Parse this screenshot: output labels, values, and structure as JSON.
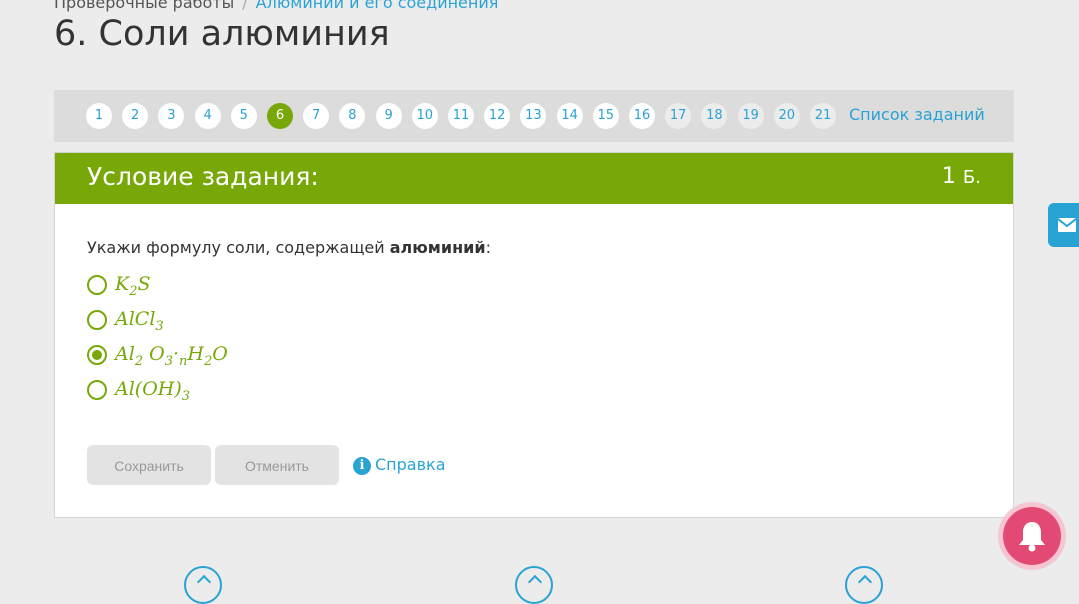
{
  "breadcrumb": {
    "parent": "Проверочные работы",
    "separator": "/",
    "current": "Алюминий и его соединения"
  },
  "page_title": "6. Соли алюминия",
  "pager": {
    "numbers": [
      "1",
      "2",
      "3",
      "4",
      "5",
      "6",
      "7",
      "8",
      "9",
      "10",
      "11",
      "12",
      "13",
      "14",
      "15",
      "16",
      "17",
      "18",
      "19",
      "20",
      "21"
    ],
    "active": "6",
    "task_list_label": "Список заданий"
  },
  "task": {
    "header_title": "Условие задания:",
    "points_value": "1",
    "points_unit": "Б.",
    "question_prefix": "Укажи формулу соли, содержащей ",
    "question_bold": "алюминий",
    "question_suffix": ":",
    "options": [
      {
        "parts": [
          [
            "K",
            ""
          ],
          [
            "2",
            "sub"
          ],
          [
            "S",
            ""
          ]
        ],
        "checked": false
      },
      {
        "parts": [
          [
            "AlCl",
            ""
          ],
          [
            "3",
            "sub"
          ]
        ],
        "checked": false
      },
      {
        "parts": [
          [
            "Al",
            ""
          ],
          [
            "2",
            "sub"
          ],
          [
            " O",
            ""
          ],
          [
            "3",
            "sub"
          ],
          [
            "·",
            ""
          ],
          [
            "n",
            "sub"
          ],
          [
            "H",
            ""
          ],
          [
            "2",
            "sub"
          ],
          [
            "O",
            ""
          ]
        ],
        "checked": true
      },
      {
        "parts": [
          [
            "Al(OH)",
            ""
          ],
          [
            "3",
            "sub"
          ]
        ],
        "checked": false
      }
    ],
    "save_label": "Сохранить",
    "cancel_label": "Отменить",
    "help_label": "Справка",
    "help_icon_glyph": "i"
  },
  "icons": {
    "mail": "envelope-icon",
    "bell": "bell-icon"
  },
  "colors": {
    "accent_green": "#77a808",
    "link_blue": "#29a3d4",
    "bell_pink": "#e34a73"
  }
}
